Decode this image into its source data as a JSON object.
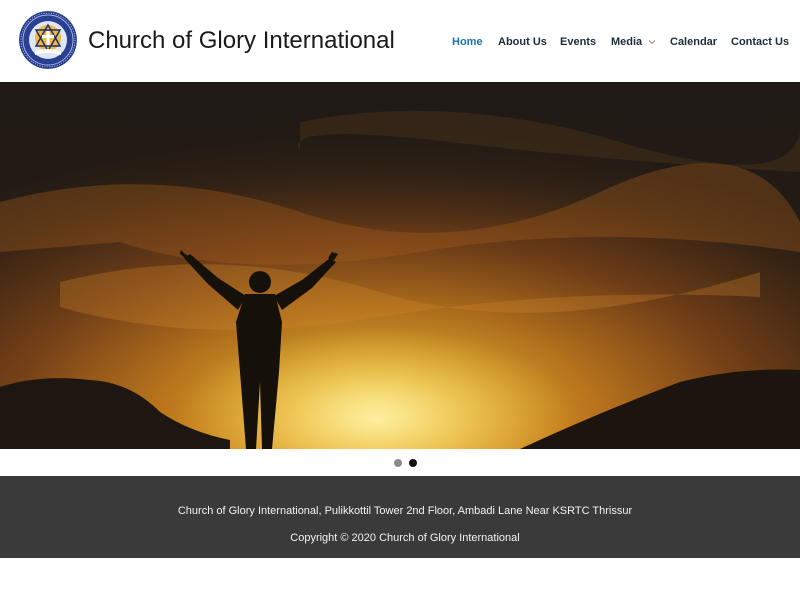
{
  "header": {
    "site_title": "Church of Glory International",
    "logo": {
      "icon": "church-emblem-logo",
      "colors": {
        "ring": "#2a3f8f",
        "inner": "#f0b93b"
      }
    },
    "nav": {
      "home": "Home",
      "about": "About Us",
      "events": "Events",
      "media": "Media",
      "calendar": "Calendar",
      "contact": "Contact Us",
      "active_item": "Home",
      "active_color": "#1c73b4"
    }
  },
  "hero": {
    "image": "silhouette-of-man-with-raised-arms-at-sunset",
    "slides_total": 2,
    "active_slide": 2
  },
  "footer": {
    "address": "Church of Glory International, Pulikkottil Tower 2nd Floor, Ambadi Lane Near KSRTC Thrissur",
    "copyright": "Copyright © 2020 Church of Glory International",
    "background": "#3a3a3a"
  }
}
